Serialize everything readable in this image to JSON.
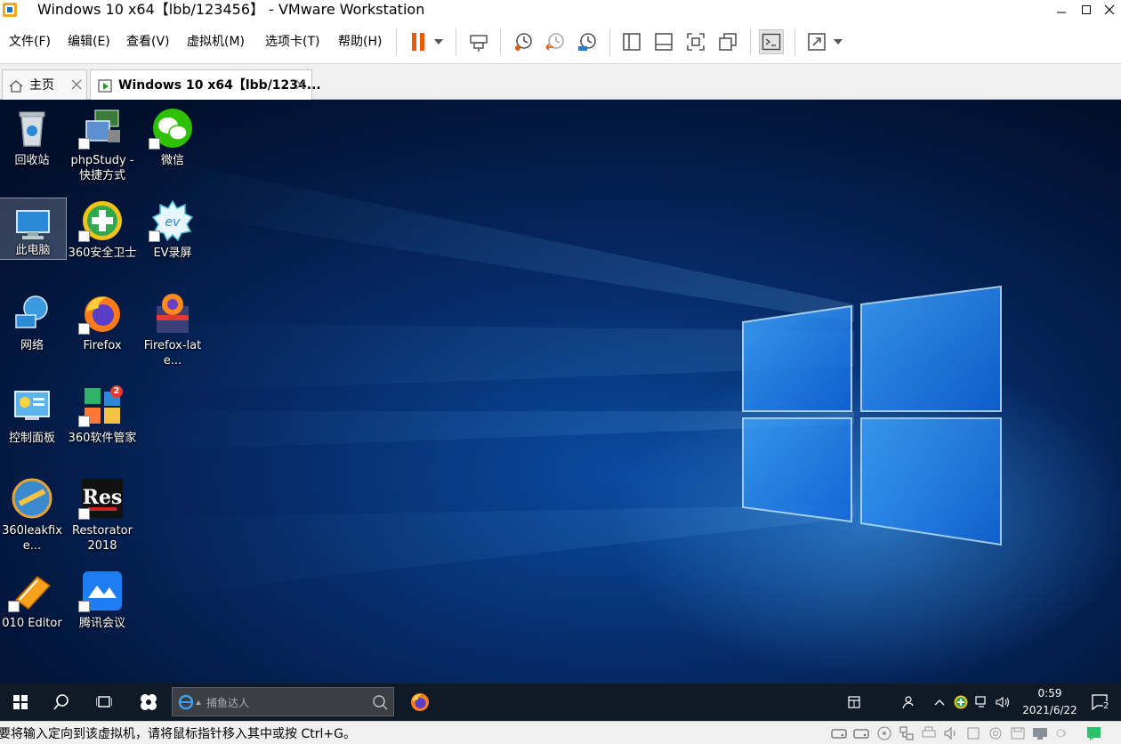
{
  "window": {
    "title": "Windows 10 x64【lbb/123456】 - VMware Workstation"
  },
  "menu": [
    {
      "label": "文件(F)"
    },
    {
      "label": "编辑(E)"
    },
    {
      "label": "查看(V)"
    },
    {
      "label": "虚拟机(M)"
    },
    {
      "label": "选项卡(T)"
    },
    {
      "label": "帮助(H)"
    }
  ],
  "toolbar": {
    "icons": [
      "pause-icon",
      "send-ctrl-alt-del-icon",
      "snapshot-icon",
      "revert-snapshot-icon",
      "snapshot-manager-icon",
      "console-view-icon",
      "thumbnail-view-icon",
      "fullscreen-icon",
      "unity-icon",
      "terminal-icon",
      "stretch-guest-icon"
    ]
  },
  "tabs": [
    {
      "label": "主页",
      "icon": "home-icon",
      "active": false
    },
    {
      "label": "Windows 10 x64【lbb/1234...",
      "icon": "vm-running-icon",
      "active": true
    }
  ],
  "desktop": {
    "icons": [
      {
        "label": "回收站",
        "icon": "recycle-bin-icon",
        "shortcut": false
      },
      {
        "label": "phpStudy - 快捷方式",
        "icon": "phpstudy-icon",
        "shortcut": true
      },
      {
        "label": "微信",
        "icon": "wechat-icon",
        "shortcut": true
      },
      {
        "label": "此电脑",
        "icon": "this-pc-icon",
        "shortcut": false,
        "selected": true
      },
      {
        "label": "360安全卫士",
        "icon": "360-security-icon",
        "shortcut": true
      },
      {
        "label": "EV录屏",
        "icon": "ev-recorder-icon",
        "shortcut": true
      },
      {
        "label": "网络",
        "icon": "network-icon",
        "shortcut": false
      },
      {
        "label": "Firefox",
        "icon": "firefox-icon",
        "shortcut": true
      },
      {
        "label": "Firefox-late...",
        "icon": "firefox-installer-icon",
        "shortcut": false
      },
      {
        "label": "控制面板",
        "icon": "control-panel-icon",
        "shortcut": false
      },
      {
        "label": "360软件管家",
        "icon": "360-software-manager-icon",
        "shortcut": true,
        "badge": "2"
      },
      {
        "label": "360leakfixe...",
        "icon": "360-leakfixer-icon",
        "shortcut": false
      },
      {
        "label": "Restorator 2018",
        "icon": "restorator-icon",
        "shortcut": true
      },
      {
        "label": "010 Editor",
        "icon": "010-editor-icon",
        "shortcut": true
      },
      {
        "label": "腾讯会议",
        "icon": "tencent-meeting-icon",
        "shortcut": true
      }
    ]
  },
  "taskbar": {
    "search_placeholder": "捕鱼达人",
    "time": "0:59",
    "date": "2021/6/22",
    "notification_count": "2",
    "tray_icons": [
      "calendar-icon",
      "people-icon",
      "show-hidden-icons-icon",
      "360-tray-icon",
      "network-tray-icon",
      "volume-icon"
    ]
  },
  "statusbar": {
    "text": "要将输入定向到该虚拟机，请将鼠标指针移入其中或按 Ctrl+G。",
    "icons": [
      "hard-disk-icon",
      "hard-disk-2-icon",
      "cd-dvd-icon",
      "network-adapter-icon",
      "printer-icon",
      "sound-icon",
      "usb-icon",
      "camera-icon",
      "floppy-icon",
      "display-icon",
      "usb-device-icon",
      "message-log-icon"
    ]
  },
  "colors": {
    "accent": "#e8590c",
    "taskbar": "#101a27",
    "desktop_glow": "#46aaff"
  }
}
